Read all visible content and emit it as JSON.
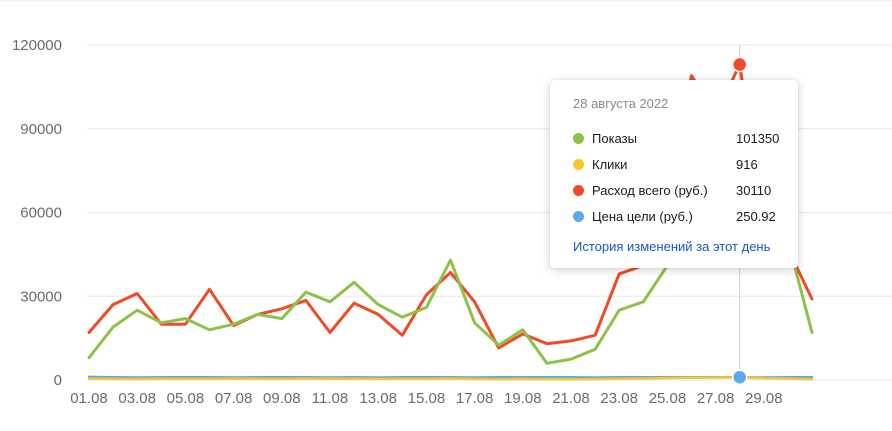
{
  "chart_data": {
    "type": "line",
    "x": [
      "01.08",
      "02.08",
      "03.08",
      "04.08",
      "05.08",
      "06.08",
      "07.08",
      "08.08",
      "09.08",
      "10.08",
      "11.08",
      "12.08",
      "13.08",
      "14.08",
      "15.08",
      "16.08",
      "17.08",
      "18.08",
      "19.08",
      "20.08",
      "21.08",
      "22.08",
      "23.08",
      "24.08",
      "25.08",
      "26.08",
      "27.08",
      "28.08",
      "29.08",
      "30.08",
      "31.08"
    ],
    "x_tick_labels": [
      "01.08",
      "03.08",
      "05.08",
      "07.08",
      "09.08",
      "11.08",
      "13.08",
      "15.08",
      "17.08",
      "19.08",
      "21.08",
      "23.08",
      "25.08",
      "27.08",
      "29.08"
    ],
    "y_ticks": [
      0,
      30000,
      60000,
      90000,
      120000
    ],
    "y_tick_labels": [
      "0",
      "30000",
      "60000",
      "90000",
      "120000"
    ],
    "ylim": [
      0,
      125000
    ],
    "grid": true,
    "series": [
      {
        "name": "Показы",
        "color": "#8bc34a",
        "values": [
          8000,
          19000,
          25000,
          20500,
          22000,
          18000,
          20000,
          23500,
          22000,
          31500,
          28000,
          35000,
          27000,
          22500,
          26000,
          43000,
          20500,
          12500,
          18000,
          6000,
          7500,
          11000,
          25000,
          28000,
          41000,
          52000,
          80000,
          101350,
          49000,
          50000,
          17000
        ]
      },
      {
        "name": "Клики",
        "color": "#f9c62b",
        "values": [
          500,
          400,
          350,
          450,
          400,
          380,
          420,
          450,
          400,
          500,
          420,
          480,
          410,
          380,
          400,
          550,
          350,
          300,
          380,
          250,
          300,
          330,
          450,
          500,
          700,
          800,
          850,
          916,
          600,
          550,
          300
        ]
      },
      {
        "name": "Расход всего (руб.)",
        "color": "#f24a26",
        "values": [
          17000,
          27000,
          31000,
          20000,
          20000,
          32500,
          19500,
          23500,
          25500,
          28500,
          17000,
          27500,
          23500,
          16000,
          30500,
          38500,
          28000,
          11500,
          16500,
          13000,
          14000,
          16000,
          38000,
          41000,
          62000,
          109000,
          95000,
          113000,
          55000,
          47000,
          29000
        ]
      },
      {
        "name": "Цена цели (руб.)",
        "color": "#5ba8ec",
        "values": [
          1100,
          1000,
          900,
          1000,
          950,
          1000,
          900,
          1000,
          950,
          950,
          900,
          950,
          900,
          1000,
          950,
          1000,
          900,
          1000,
          950,
          1000,
          1000,
          900,
          950,
          1000,
          1000,
          950,
          1000,
          1000,
          900,
          950,
          1000
        ]
      }
    ],
    "hover_index": 27
  },
  "tooltip": {
    "date": "28 августа 2022",
    "rows": [
      {
        "label": "Показы",
        "value": "101350",
        "color": "#8bc34a"
      },
      {
        "label": "Клики",
        "value": "916",
        "color": "#f9c62b"
      },
      {
        "label": "Расход всего (руб.)",
        "value": "30110",
        "color": "#f24a26"
      },
      {
        "label": "Цена цели (руб.)",
        "value": "250.92",
        "color": "#5ba8ec"
      }
    ],
    "link": "История изменений за этот день"
  }
}
